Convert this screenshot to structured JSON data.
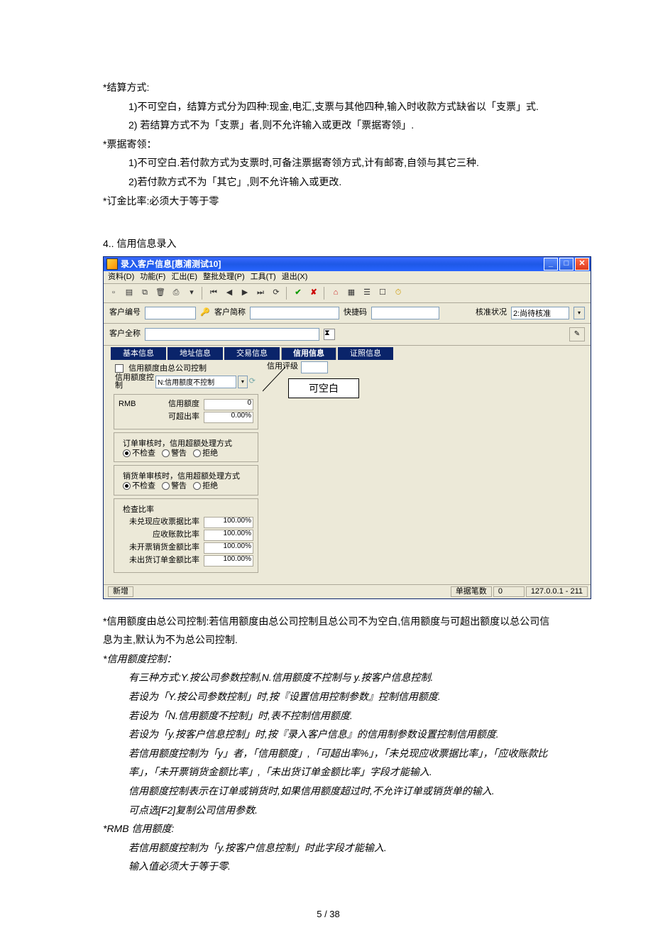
{
  "doc": {
    "p1": "*结算方式:",
    "p1a": "1)不可空白，结算方式分为四种:现金,电汇,支票与其他四种,输入时收款方式缺省以「支票」式.",
    "p1b": "2) 若结算方式不为「支票」者,则不允许输入或更改「票据寄领」.",
    "p2": "*票据寄领：",
    "p2a": "1)不可空白.若付款方式为支票时,可备注票据寄领方式,计有邮寄,自领与其它三种.",
    "p2b": "2)若付款方式不为「其它」,则不允许输入或更改.",
    "p3": "*订金比率:必须大于等于零",
    "p4": "4.. 信用信息录入",
    "p5": "*信用额度由总公司控制:若信用额度由总公司控制且总公司不为空白,信用额度与可超出额度以总公司信息为主,默认为不为总公司控制.",
    "p6": "*信用额度控制：",
    "p6a": "有三种方式:Y.按公司参数控制,N.信用额度不控制与 y.按客户信息控制.",
    "p6b": "若设为「Y.按公司参数控制」时,按『设置信用控制参数』控制信用额度.",
    "p6c": "若设为「N.信用额度不控制」时,表不控制信用额度.",
    "p6d": "若设为「y.按客户信息控制」时,按『录入客户信息』的信用制参数设置控制信用额度.",
    "p6e": "若信用额度控制为「y」者，「信用额度」,「可超出率%」，「未兑现应收票据比率」，「应收账款比率」，「未开票销货金额比率」,「未出货订单金额比率」字段才能输入.",
    "p6f": "信用额度控制表示在订单或销货时,如果信用额度超过时,不允许订单或销货单的输入.",
    "p6g": "可点选[F2]复制公司信用参数.",
    "p7": "*RMB 信用额度:",
    "p7a": "若信用额度控制为「y.按客户信息控制」时此字段才能输入.",
    "p7b": "输入值必须大于等于零.",
    "page_no": "5  /  38"
  },
  "app": {
    "title": "录入客户信息[惠浦测试10]",
    "menus": [
      "资料(D)",
      "功能(F)",
      "汇出(E)",
      "整批处理(P)",
      "工具(T)",
      "退出(X)"
    ],
    "header": {
      "cust_no_label": "客户编号",
      "cust_short_label": "客户简称",
      "quick_label": "快捷码",
      "approve_label": "核准状况",
      "approve_value": "2:尚待核准",
      "cust_full_label": "客户全称"
    },
    "tabs": [
      "基本信息",
      "地址信息",
      "交易信息",
      "信用信息",
      "证照信息"
    ],
    "active_tab": "信用信息",
    "credit": {
      "by_head_label": "信用额度由总公司控制",
      "ctrl_label": "信用额度控制",
      "ctrl_value": "N:信用额度不控制",
      "currency": "RMB",
      "limit_label": "信用额度",
      "limit_value": "0",
      "over_label": "可超出率",
      "over_value": "0.00%",
      "order_group": "订单审核时，信用超额处理方式",
      "ship_group": "销货单审核时，信用超额处理方式",
      "opt_nocheck": "不检查",
      "opt_warn": "警告",
      "opt_reject": "拒绝",
      "ratio_group": "检查比率",
      "r1_label": "未兑现应收票据比率",
      "r1_value": "100.00%",
      "r2_label": "应收账款比率",
      "r2_value": "100.00%",
      "r3_label": "未开票销货金额比率",
      "r3_value": "100.00%",
      "r4_label": "未出货订单金额比率",
      "r4_value": "100.00%",
      "rating_label": "信用评级",
      "callout": "可空白"
    },
    "status": {
      "mode": "新增",
      "count_label": "单据笔数",
      "count_value": "0",
      "server": "127.0.0.1 - 211"
    }
  }
}
